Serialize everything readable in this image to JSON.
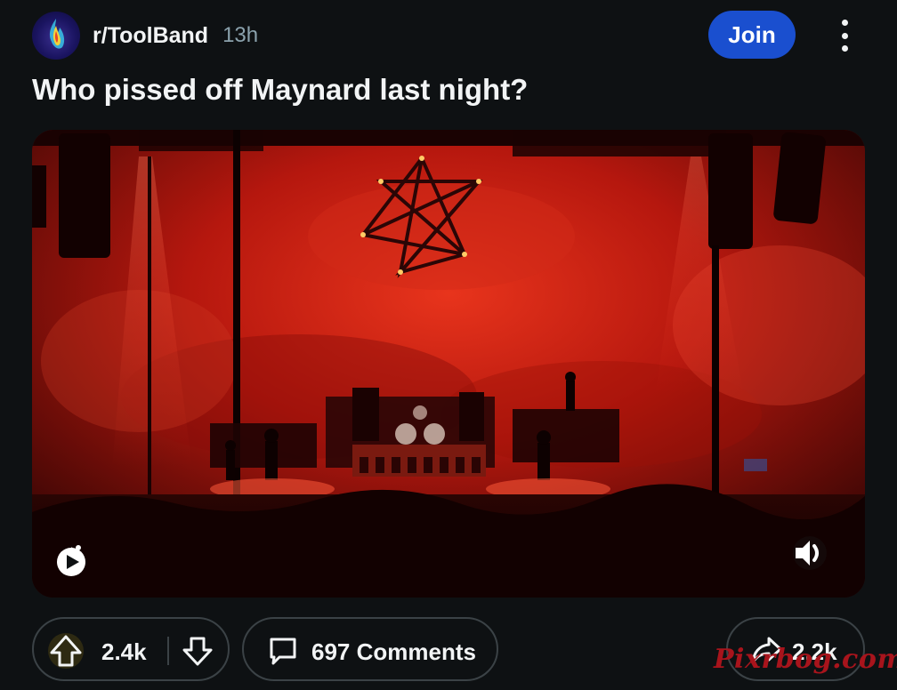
{
  "header": {
    "subreddit": "r/ToolBand",
    "time": "13h",
    "join_label": "Join"
  },
  "post": {
    "title": "Who pissed off Maynard last night?"
  },
  "actions": {
    "upvote_count": "2.4k",
    "comments_label": "697 Comments",
    "share_count": "2.2k"
  },
  "watermark": "Pixrbog.com",
  "icons": {
    "avatar": "subreddit-avatar",
    "more": "more-options-icon",
    "upvote": "upvote-icon",
    "downvote": "downvote-icon",
    "comment": "comment-icon",
    "share": "share-icon",
    "media_badge": "reddit-video-icon",
    "volume": "volume-icon"
  },
  "colors": {
    "background": "#0e1113",
    "join_button": "#1a4fcf",
    "pill_border": "#3b4246",
    "stage_red": "#c41a10",
    "watermark": "#a8141c"
  }
}
